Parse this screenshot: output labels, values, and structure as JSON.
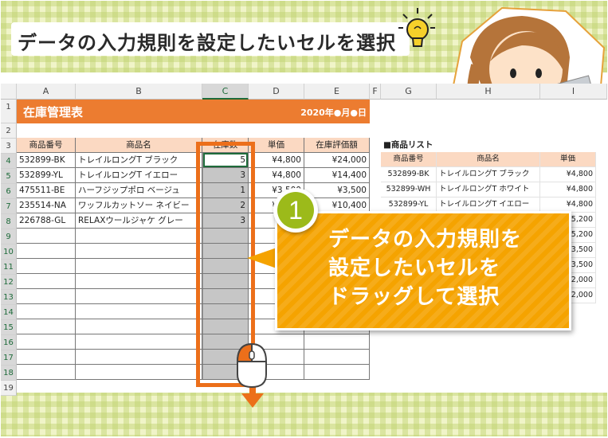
{
  "title": "データの入力規則を設定したいセルを選択",
  "spreadsheet": {
    "columns": [
      "A",
      "B",
      "C",
      "D",
      "E",
      "F",
      "G",
      "H",
      "I"
    ],
    "selected_column": "C",
    "rows": [
      "1",
      "2",
      "3",
      "4",
      "5",
      "6",
      "7",
      "8",
      "9",
      "10",
      "11",
      "12",
      "13",
      "14",
      "15",
      "16",
      "17",
      "18",
      "19"
    ],
    "banner_title": "在庫管理表",
    "banner_date": "2020年●月●日",
    "table_headers": [
      "商品番号",
      "商品名",
      "在庫数",
      "単価",
      "在庫評価額"
    ],
    "table_rows": [
      [
        "532899-BK",
        "トレイルロングT ブラック",
        "5",
        "¥4,800",
        "¥24,000"
      ],
      [
        "532899-YL",
        "トレイルロングT イエロー",
        "3",
        "¥4,800",
        "¥14,400"
      ],
      [
        "475511-BE",
        "ハーフジップポロ ベージュ",
        "1",
        "¥3,500",
        "¥3,500"
      ],
      [
        "235514-NA",
        "ワッフルカットソー ネイビー",
        "2",
        "¥3,500",
        "¥10,400"
      ],
      [
        "226788-GL",
        "RELAXウールジャケ グレー",
        "3",
        "",
        ""
      ]
    ],
    "list_title": "■商品リスト",
    "list_headers": [
      "商品番号",
      "商品名",
      "単価"
    ],
    "list_rows": [
      [
        "532899-BK",
        "トレイルロングT ブラック",
        "¥4,800"
      ],
      [
        "532899-WH",
        "トレイルロングT ホワイト",
        "¥4,800"
      ],
      [
        "532899-YL",
        "トレイルロングT イエロー",
        "¥4,800"
      ],
      [
        "",
        "",
        "¥5,200"
      ],
      [
        "",
        "",
        "¥5,200"
      ],
      [
        "",
        "",
        "¥3,500"
      ],
      [
        "",
        "",
        "¥3,500"
      ],
      [
        "",
        "",
        "¥2,000"
      ],
      [
        "",
        "",
        "¥2,000"
      ]
    ]
  },
  "callout": {
    "step_number": "1",
    "lines": [
      "データの入力規則を",
      "設定したいセルを",
      "ドラッグして選択"
    ]
  },
  "colors": {
    "accent_orange": "#ec7c30",
    "callout_orange": "#f5a300",
    "badge_green": "#9cba1a",
    "header_peach": "#fbd9c2"
  }
}
